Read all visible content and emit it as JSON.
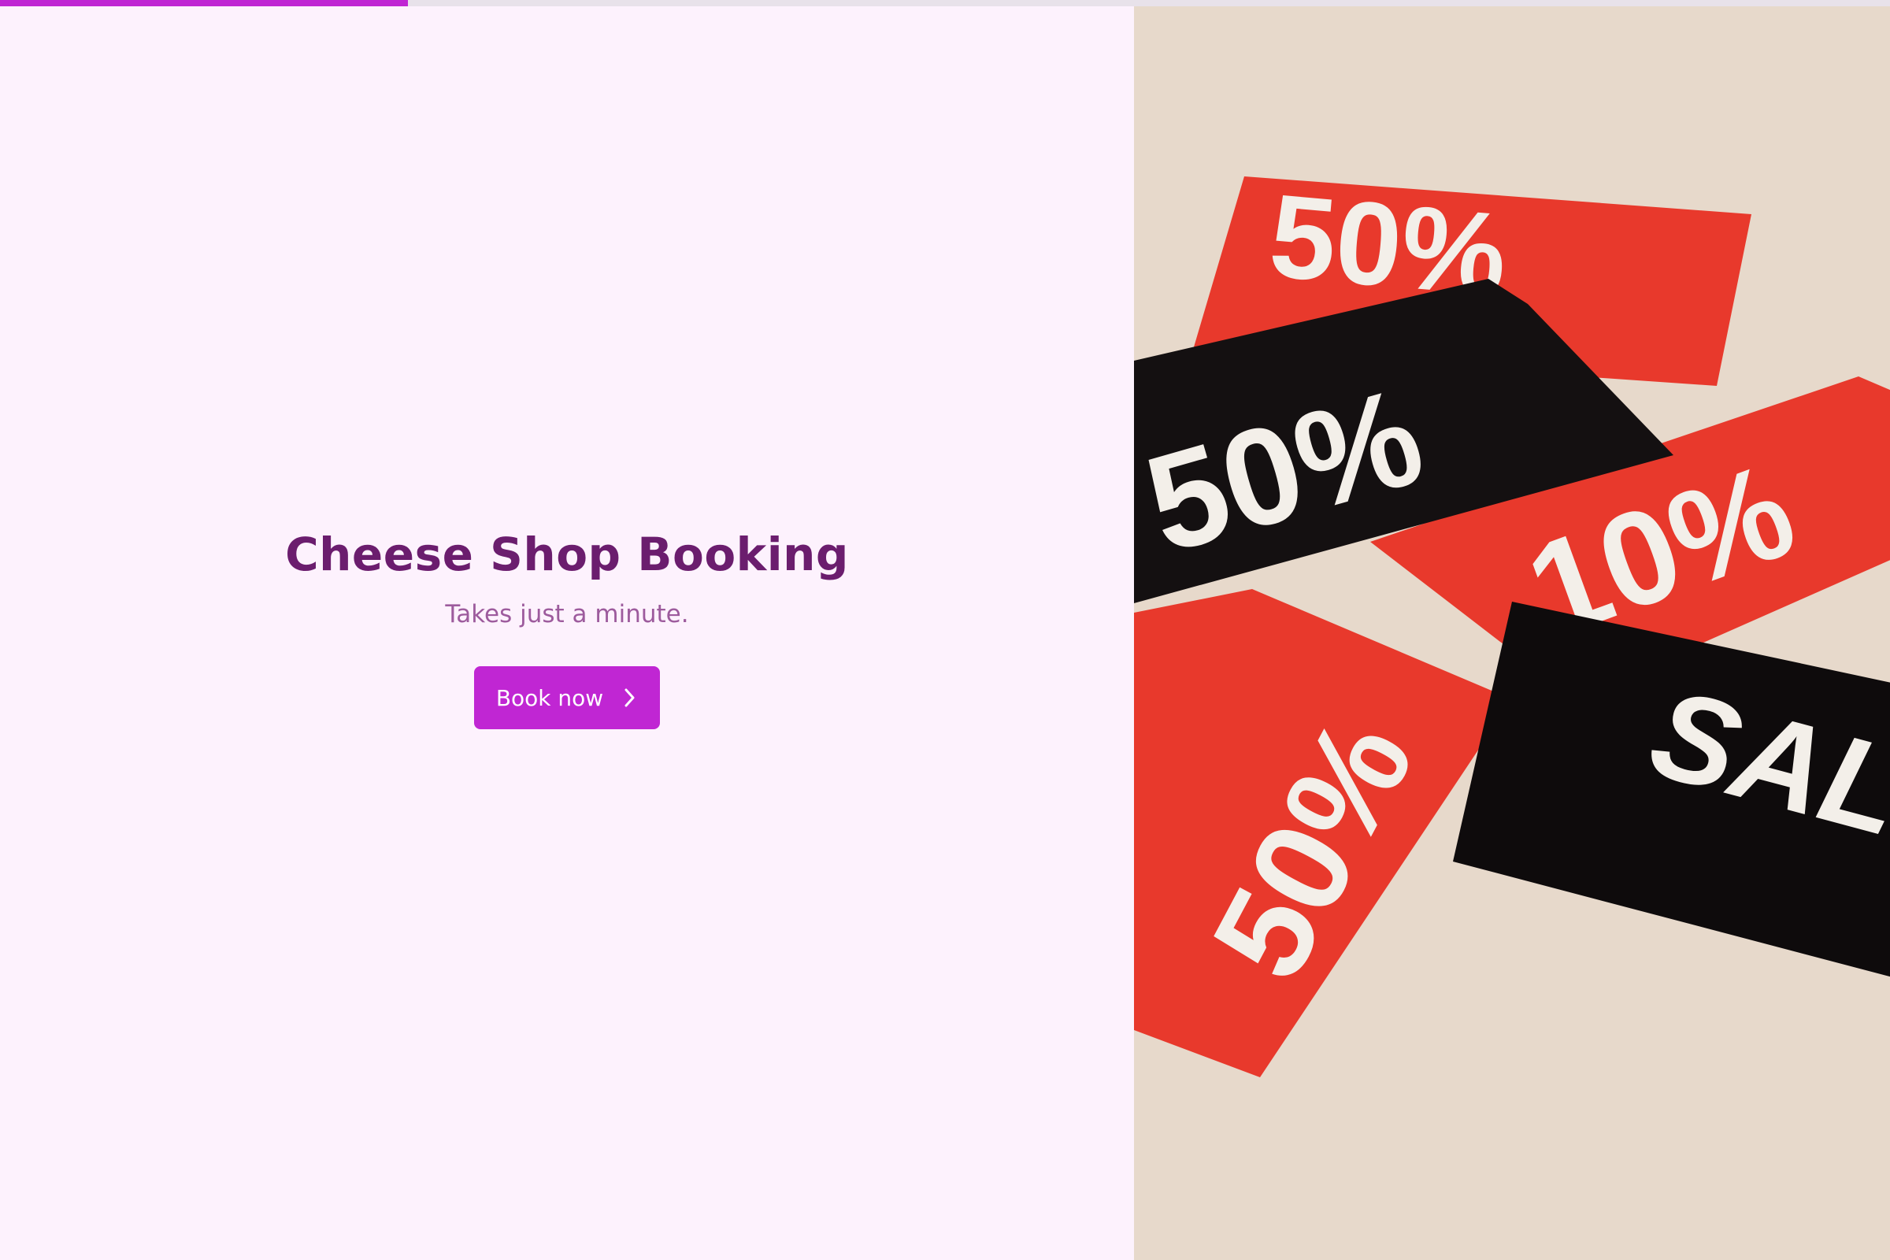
{
  "progress": {
    "fraction": 0.216,
    "color": "#c026d3"
  },
  "hero": {
    "title": "Cheese Shop Booking",
    "subtitle": "Takes just a minute.",
    "cta_label": "Book now",
    "cta_icon": "chevron-right-icon"
  },
  "image": {
    "subject": "sale-price-tags-photo",
    "tags": [
      "50%",
      "50%",
      "10%",
      "50%",
      "SALE"
    ]
  },
  "colors": {
    "background": "#fdf2fd",
    "title": "#6b1d6e",
    "subtitle": "#9d5b9d",
    "accent": "#c026d3",
    "photo_background": "#e7d9cb",
    "tag_red": "#e8392c",
    "tag_black": "#111111"
  }
}
